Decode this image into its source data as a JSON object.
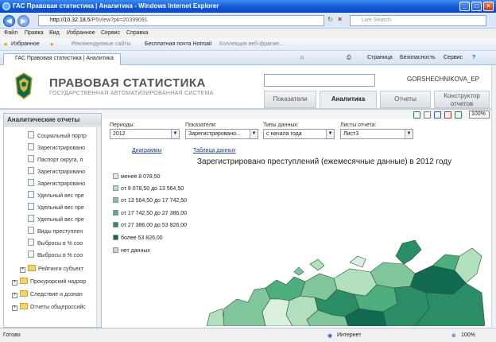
{
  "window": {
    "title": "ГАС Правовая статистика | Аналитика - Windows Internet Explorer"
  },
  "address": {
    "url_host": "http://10.32.18.5",
    "url_path": "/P5View?pk=20399091",
    "search_placeholder": "Live Search"
  },
  "menu": [
    "Файл",
    "Правка",
    "Вид",
    "Избранное",
    "Сервис",
    "Справка"
  ],
  "favorites": {
    "label": "Избранное",
    "items": [
      "Рекомендуемые сайты",
      "Бесплатная почта Hotmail",
      "Коллекция веб-фрагме..."
    ]
  },
  "browser_tab": {
    "label": "ГАС Правовая статистика | Аналитика",
    "commands": [
      "Страница",
      "Безопасность",
      "Сервис"
    ]
  },
  "header": {
    "brand_title": "ПРАВОВАЯ СТАТИСТИКА",
    "brand_subtitle": "ГОСУДАРСТВЕННАЯ АВТОМАТИЗИРОВАННАЯ СИСТЕМА",
    "user": "GORSHECHNIKOVA_EP"
  },
  "nav_tabs": [
    {
      "label": "Показатели",
      "active": false
    },
    {
      "label": "Аналитика",
      "active": true
    },
    {
      "label": "Отчеты",
      "active": false
    },
    {
      "label": "Конструктор отчетов",
      "active": false
    }
  ],
  "toolbar": {
    "zoom": "100%"
  },
  "left_panel": {
    "title": "Аналитические отчеты",
    "docs": [
      "Социальный портр",
      "Зарегистрировано",
      "Паспорт округа, п",
      "Зарегистрировано",
      "Зарегистрировано",
      "Удельный вес пре",
      "Удельный вес пре",
      "Удельный вес пре",
      "Виды преступлен",
      "Выбросы в % соо",
      "Выбросы в % соо"
    ],
    "sub_folder": "Рейтинги субъект",
    "folders": [
      "Прокурорский надзор",
      "Следствие и дознан",
      "Отчеты общероссийс"
    ]
  },
  "filters": {
    "periods": {
      "label": "Периоды:",
      "value": "2012"
    },
    "indicators": {
      "label": "Показатели:",
      "value": "Зарегистрировано..."
    },
    "data_types": {
      "label": "Типы данных:",
      "value": "с начала года"
    },
    "sheets": {
      "label": "Листы отчета:",
      "value": "Лист3"
    }
  },
  "report_links": {
    "charts": "Диаграммы",
    "table": "Таблица данных"
  },
  "map": {
    "title": "Зарегистрировано преступлений (ежемесячные данные) в 2012 году",
    "legend": [
      {
        "label": "менее 8 078,50",
        "color": "#d9f0de"
      },
      {
        "label": "от 8 078,50 до 13 564,50",
        "color": "#b2dfbd"
      },
      {
        "label": "от 13 564,50 до 17 742,50",
        "color": "#7fc79a"
      },
      {
        "label": "от 17 742,50 до 27 386,00",
        "color": "#4fae7e"
      },
      {
        "label": "от 27 386,00 до 53 826,00",
        "color": "#2a8d66"
      },
      {
        "label": "более 53 826,00",
        "color": "#11694f"
      },
      {
        "label": "нет данных",
        "color": "#cfcfcf"
      }
    ]
  },
  "status": {
    "left": "Готово",
    "zone": "Интернет",
    "zoom": "100%"
  }
}
